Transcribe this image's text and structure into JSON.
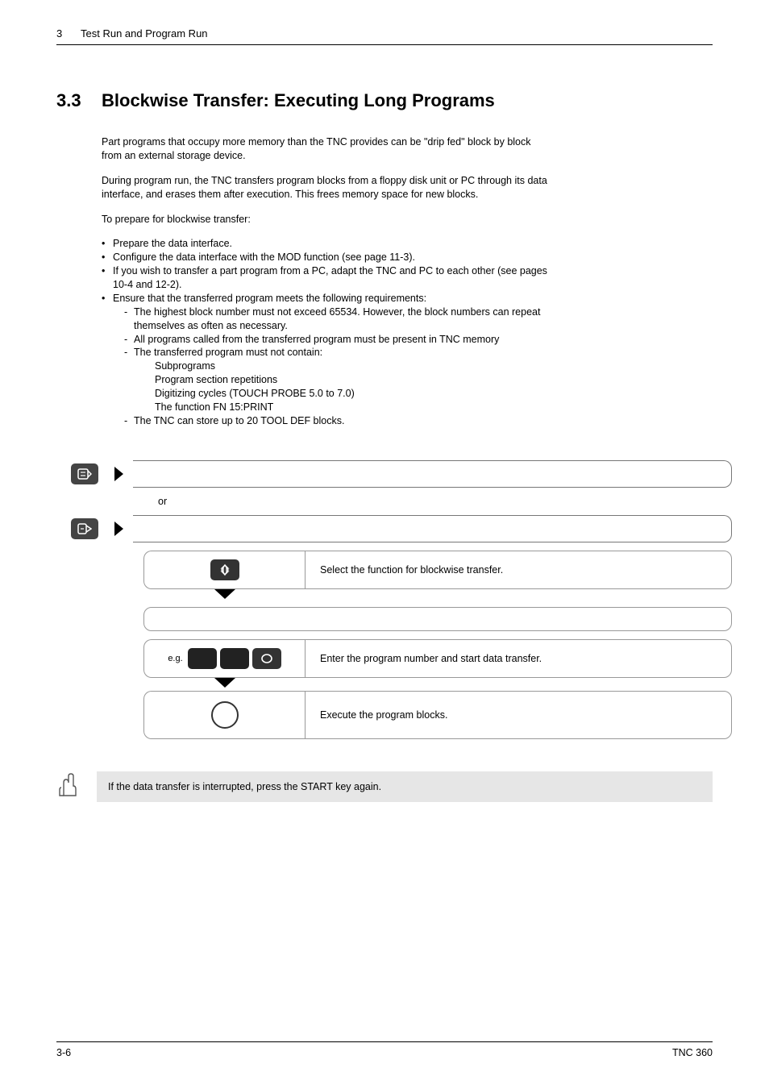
{
  "header": {
    "chapter_num": "3",
    "chapter_title": "Test Run and Program Run"
  },
  "section": {
    "num": "3.3",
    "title": "Blockwise Transfer: Executing Long Programs"
  },
  "para1": "Part programs that occupy more memory than the TNC provides can be \"drip fed\" block by block from an external storage device.",
  "para2": "During program run, the TNC transfers program blocks from a floppy disk unit or PC through its data interface, and erases them after execution. This frees memory space for new blocks.",
  "para3": "To prepare for blockwise transfer:",
  "bullets": {
    "b1": "Prepare the data interface.",
    "b2": "Configure the data interface with the MOD function (see page 11-3).",
    "b3": "If you wish to transfer a part program from a PC, adapt the TNC and PC to each other (see pages 10-4 and 12-2).",
    "b4": "Ensure that the transferred program meets the following requirements:",
    "b4_1": "The highest block number must not exceed 65534. However, the block numbers can repeat themselves as often as necessary.",
    "b4_2": "All programs called from the transferred program must be present in TNC memory",
    "b4_3": "The transferred program must not contain:",
    "b4_3a": "Subprograms",
    "b4_3b": "Program section repetitions",
    "b4_3c": "Digitizing cycles (TOUCH PROBE 5.0 to 7.0)",
    "b4_3d": "The function FN 15:PRINT",
    "b4_4": "The TNC can store up to 20 TOOL DEF blocks."
  },
  "flow": {
    "or": "or",
    "step1": "Select the function for blockwise transfer.",
    "eg": "e.g.",
    "step2": "Enter the program number and start data transfer.",
    "step3": "Execute the program blocks."
  },
  "note": "If the data transfer is interrupted, press the START key again.",
  "footer": {
    "left": "3-6",
    "right": "TNC 360"
  }
}
